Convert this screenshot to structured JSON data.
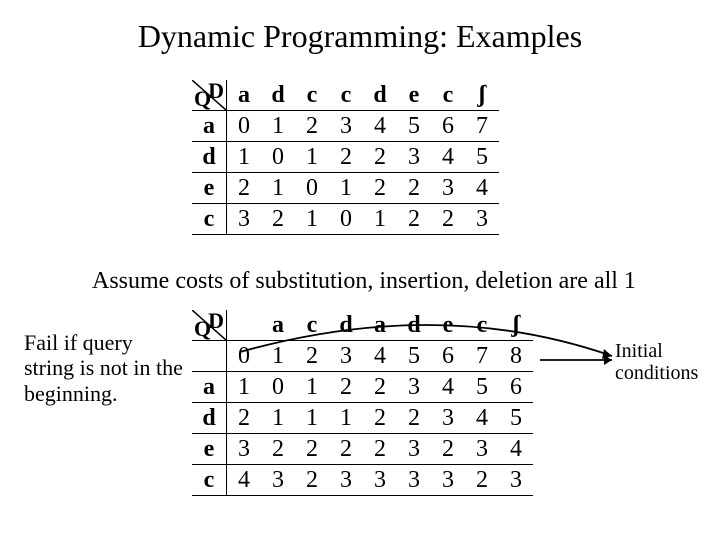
{
  "title": "Dynamic Programming: Examples",
  "assume": "Assume costs of substitution, insertion, deletion are all 1",
  "fail_note": "Fail if query string is not in the beginning.",
  "init_note_1": "Initial",
  "init_note_2": "conditions",
  "corner": {
    "D": "D",
    "Q": "Q"
  },
  "table1": {
    "cols": [
      "a",
      "d",
      "c",
      "c",
      "d",
      "e",
      "c",
      "ʃ"
    ],
    "rows": [
      {
        "h": "a",
        "v": [
          "0",
          "1",
          "2",
          "3",
          "4",
          "5",
          "6",
          "7"
        ]
      },
      {
        "h": "d",
        "v": [
          "1",
          "0",
          "1",
          "2",
          "2",
          "3",
          "4",
          "5"
        ]
      },
      {
        "h": "e",
        "v": [
          "2",
          "1",
          "0",
          "1",
          "2",
          "2",
          "3",
          "4"
        ]
      },
      {
        "h": "c",
        "v": [
          "3",
          "2",
          "1",
          "0",
          "1",
          "2",
          "2",
          "3"
        ]
      }
    ]
  },
  "table2": {
    "cols": [
      "",
      "a",
      "c",
      "d",
      "a",
      "d",
      "e",
      "c",
      "ʃ"
    ],
    "rows": [
      {
        "h": "",
        "v": [
          "0",
          "1",
          "2",
          "3",
          "4",
          "5",
          "6",
          "7",
          "8"
        ]
      },
      {
        "h": "a",
        "v": [
          "1",
          "0",
          "1",
          "2",
          "2",
          "3",
          "4",
          "5",
          "6"
        ]
      },
      {
        "h": "d",
        "v": [
          "2",
          "1",
          "1",
          "1",
          "2",
          "2",
          "3",
          "4",
          "5"
        ]
      },
      {
        "h": "e",
        "v": [
          "3",
          "2",
          "2",
          "2",
          "2",
          "3",
          "2",
          "3",
          "4"
        ]
      },
      {
        "h": "c",
        "v": [
          "4",
          "3",
          "2",
          "3",
          "3",
          "3",
          "3",
          "2",
          "3"
        ]
      }
    ]
  },
  "chart_data": [
    {
      "type": "table",
      "title": "Edit-distance DP matrix (prefix-matched)",
      "note": "Costs of substitution, insertion, deletion are all 1",
      "query_label": "Q",
      "database_label": "D",
      "columns": [
        "a",
        "d",
        "c",
        "c",
        "d",
        "e",
        "c",
        "ʃ"
      ],
      "rows": [
        "a",
        "d",
        "e",
        "c"
      ],
      "values": [
        [
          0,
          1,
          2,
          3,
          4,
          5,
          6,
          7
        ],
        [
          1,
          0,
          1,
          2,
          2,
          3,
          4,
          5
        ],
        [
          2,
          1,
          0,
          1,
          2,
          2,
          3,
          4
        ],
        [
          3,
          2,
          1,
          0,
          1,
          2,
          2,
          3
        ]
      ]
    },
    {
      "type": "table",
      "title": "Edit-distance DP matrix with initial conditions row/column",
      "note": "Fail if query string is not in the beginning; first row/column are initial conditions",
      "query_label": "Q",
      "database_label": "D",
      "columns": [
        "",
        "a",
        "c",
        "d",
        "a",
        "d",
        "e",
        "c",
        "ʃ"
      ],
      "rows": [
        "",
        "a",
        "d",
        "e",
        "c"
      ],
      "values": [
        [
          0,
          1,
          2,
          3,
          4,
          5,
          6,
          7,
          8
        ],
        [
          1,
          0,
          1,
          2,
          2,
          3,
          4,
          5,
          6
        ],
        [
          2,
          1,
          1,
          1,
          2,
          2,
          3,
          4,
          5
        ],
        [
          3,
          2,
          2,
          2,
          2,
          3,
          2,
          3,
          4
        ],
        [
          4,
          3,
          2,
          3,
          3,
          3,
          3,
          2,
          3
        ]
      ]
    }
  ]
}
